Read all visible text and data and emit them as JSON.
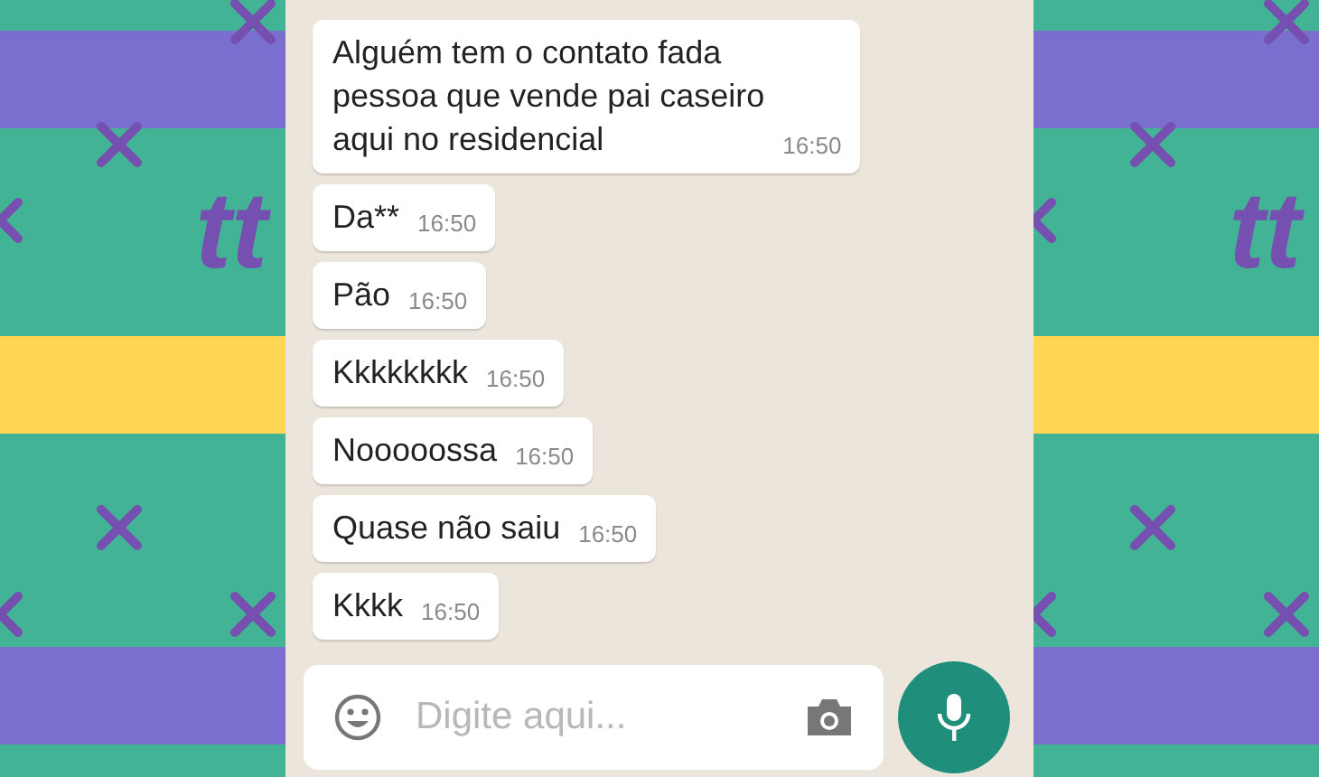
{
  "side_logos": [
    {
      "text": "tt"
    },
    {
      "text": "tt"
    }
  ],
  "messages": [
    {
      "text": "Alguém tem o contato fada\npessoa que vende pai caseiro\naqui no residencial",
      "time": "16:50"
    },
    {
      "text": "Da**",
      "time": "16:50"
    },
    {
      "text": "Pão",
      "time": "16:50"
    },
    {
      "text": "Kkkkkkkk",
      "time": "16:50"
    },
    {
      "text": "Nooooossa",
      "time": "16:50"
    },
    {
      "text": "Quase não saiu",
      "time": "16:50"
    },
    {
      "text": "Kkkk",
      "time": "16:50"
    }
  ],
  "composer": {
    "placeholder": "Digite aqui..."
  }
}
